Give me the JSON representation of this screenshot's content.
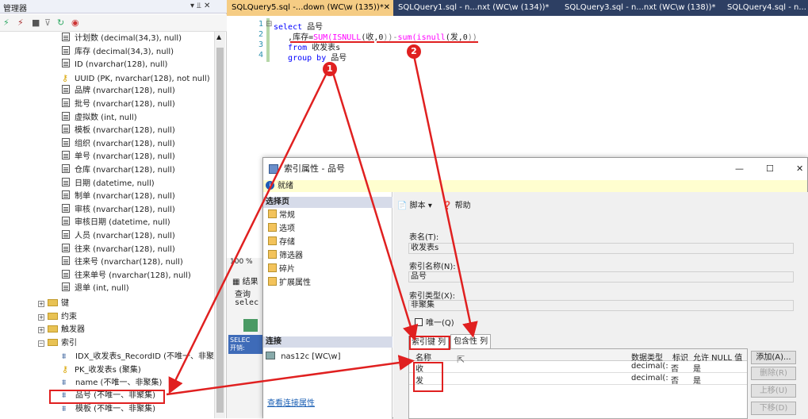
{
  "object_explorer": {
    "title": "管理器",
    "pin_label": "▾ ⫫ ✕",
    "columns": [
      {
        "label": "计划数 (decimal(34,3), null)",
        "icon": "column-icon"
      },
      {
        "label": "库存 (decimal(34,3), null)",
        "icon": "column-icon"
      },
      {
        "label": "ID (nvarchar(128), null)",
        "icon": "column-icon"
      },
      {
        "label": "UUID (PK, nvarchar(128), not null)",
        "icon": "key-icon"
      },
      {
        "label": "品牌 (nvarchar(128), null)",
        "icon": "column-icon"
      },
      {
        "label": "批号 (nvarchar(128), null)",
        "icon": "column-icon"
      },
      {
        "label": "虚拟数 (int, null)",
        "icon": "column-icon"
      },
      {
        "label": "模板 (nvarchar(128), null)",
        "icon": "column-icon"
      },
      {
        "label": "组织 (nvarchar(128), null)",
        "icon": "column-icon"
      },
      {
        "label": "单号 (nvarchar(128), null)",
        "icon": "column-icon"
      },
      {
        "label": "仓库 (nvarchar(128), null)",
        "icon": "column-icon"
      },
      {
        "label": "日期 (datetime, null)",
        "icon": "column-icon"
      },
      {
        "label": "制单 (nvarchar(128), null)",
        "icon": "column-icon"
      },
      {
        "label": "审核 (nvarchar(128), null)",
        "icon": "column-icon"
      },
      {
        "label": "审核日期 (datetime, null)",
        "icon": "column-icon"
      },
      {
        "label": "人员 (nvarchar(128), null)",
        "icon": "column-icon"
      },
      {
        "label": "往来 (nvarchar(128), null)",
        "icon": "column-icon"
      },
      {
        "label": "往来号 (nvarchar(128), null)",
        "icon": "column-icon"
      },
      {
        "label": "往来单号 (nvarchar(128), null)",
        "icon": "column-icon"
      },
      {
        "label": "退单 (int, null)",
        "icon": "column-icon"
      }
    ],
    "folders": [
      "键",
      "约束",
      "触发器",
      "索引"
    ],
    "indexes": [
      {
        "label": "IDX_收发表s_RecordID (不唯一、非聚",
        "icon": "index-icon"
      },
      {
        "label": "PK_收发表s (聚集)",
        "icon": "key-icon"
      },
      {
        "label": "name (不唯一、非聚集)",
        "icon": "index-icon"
      },
      {
        "label": "品号 (不唯一、非聚集)",
        "icon": "index-icon"
      },
      {
        "label": "模板 (不唯一、非聚集)",
        "icon": "index-icon"
      }
    ]
  },
  "tabs": [
    {
      "label": "SQLQuery5.sql -...down (WC\\w (135))*",
      "close": "✕",
      "active": true
    },
    {
      "label": "SQLQuery1.sql - n...nxt (WC\\w (134))*",
      "active": false
    },
    {
      "label": "SQLQuery3.sql - n...nxt (WC\\w (138))*",
      "active": false
    },
    {
      "label": "SQLQuery4.sql - n...",
      "active": false
    }
  ],
  "editor": {
    "line_numbers": [
      "1",
      "2",
      "3",
      "4"
    ],
    "line1_kw": "select",
    "line1_rest": " 品号",
    "line2_pre": "   ,库存=",
    "line2_sum": "SUM",
    "line2_isnull1": "(ISNULL",
    "line2_mid1": "(收,",
    "line2_zero1": "0",
    "line2_mid2": "))-",
    "line2_sum2": "sum",
    "line2_isnull2": "(isnull",
    "line2_mid3": "(发,",
    "line2_zero2": "0",
    "line2_end": "))",
    "line3_kw": "   from",
    "line3_rest": " 收发表s",
    "line4_kw": "   group by",
    "line4_rest": " 品号",
    "collapse_marker": "⊟"
  },
  "background_fragments": {
    "zoom": "100 %",
    "results": "结果",
    "query": "查询",
    "select": "selec",
    "status_select": "SELEC",
    "status_start": "开销:"
  },
  "dialog": {
    "title": "索引属性 - 品号",
    "controls": [
      "—",
      "☐",
      "✕"
    ],
    "ready": "就绪",
    "select_page_header": "选择页",
    "pages": [
      "常规",
      "选项",
      "存储",
      "筛选器",
      "碎片",
      "扩展属性"
    ],
    "connection_header": "连接",
    "connection_value": "nas12c [WC\\w]",
    "connection_link": "查看连接属性",
    "toolbar_script": "脚本",
    "toolbar_help": "帮助",
    "table_label": "表名(T):",
    "table_value": "收发表s",
    "index_name_label": "索引名称(N):",
    "index_name_value": "品号",
    "index_type_label": "索引类型(X):",
    "index_type_value": "非聚集",
    "unique_label": "唯一(Q)",
    "tab_key_columns": "索引键 列",
    "tab_included_columns": "包含性 列",
    "grid_headers": [
      "名称",
      "数据类型",
      "标识",
      "允许 NULL 值"
    ],
    "grid_rows": [
      {
        "name": "收",
        "type": "decimal(:",
        "identity": "否",
        "nullable": "是"
      },
      {
        "name": "发",
        "type": "decimal(:",
        "identity": "否",
        "nullable": "是"
      }
    ],
    "buttons": {
      "add": "添加(A)...",
      "remove": "删除(R)",
      "up": "上移(U)",
      "down": "下移(D)"
    }
  },
  "annotations": {
    "badge1": "1",
    "badge2": "2"
  },
  "colors": {
    "annotation": "#e02020",
    "active_tab": "#f5cc84",
    "tab_bar": "#2d3f63"
  }
}
